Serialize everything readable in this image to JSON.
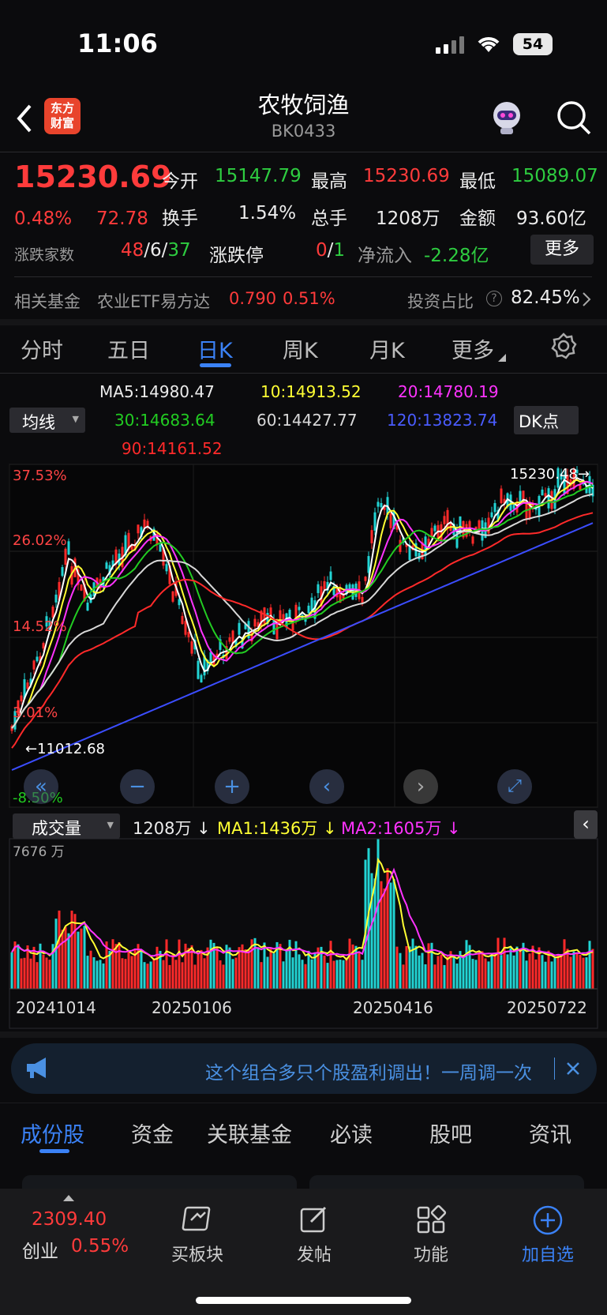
{
  "status": {
    "time": "11:06",
    "battery": "54"
  },
  "header": {
    "title": "农牧饲渔",
    "code": "BK0433",
    "logo_text": "东方财富"
  },
  "quote": {
    "price": "15230.69",
    "change_pct": "0.48%",
    "change": "72.78",
    "open_label": "今开",
    "open": "15147.79",
    "high_label": "最高",
    "high": "15230.69",
    "low_label": "最低",
    "low": "15089.07",
    "turnover_label": "换手",
    "turnover": "1.54%",
    "volume_label": "总手",
    "volume": "1208万",
    "amount_label": "金额",
    "amount": "93.60亿",
    "updown_label": "涨跌家数",
    "up": "48",
    "flat": "6",
    "down": "37",
    "limit_label": "涨跌停",
    "limit_up": "0",
    "limit_down": "1",
    "netflow_label": "净流入",
    "netflow": "-2.28亿",
    "more_label": "更多"
  },
  "fund": {
    "label": "相关基金",
    "name": "农业ETF易方达",
    "price": "0.790",
    "pct": "0.51%",
    "ratio_label": "投资占比",
    "ratio": "82.45%"
  },
  "tabs": [
    "分时",
    "五日",
    "日K",
    "周K",
    "月K",
    "更多"
  ],
  "ma_panel": {
    "selector": "均线",
    "ma5": "MA5:14980.47",
    "ma10": "10:14913.52",
    "ma20": "20:14780.19",
    "ma30": "30:14683.64",
    "ma60": "60:14427.77",
    "ma120": "120:13823.74",
    "ma90": "90:14161.52",
    "dk": "DK点"
  },
  "chart": {
    "y_labels": [
      "37.53%",
      "26.02%",
      "14.52%",
      "3.01%",
      "-8.50%"
    ],
    "high_mark": "15230.48",
    "low_mark": "11012.68",
    "colors": {
      "ma5": "#ffffff",
      "ma10": "#ffff33",
      "ma20": "#ff33ff",
      "ma30": "#22cc22",
      "ma60": "#d8d8d8",
      "ma120": "#3b4dff",
      "ma90": "#ff2a2a"
    }
  },
  "volume": {
    "selector": "成交量",
    "vol": "1208万",
    "ma1": "MA1:1436万",
    "ma2": "MA2:1605万",
    "max_label": "7676 万",
    "dates": [
      "20241014",
      "20250106",
      "20250416",
      "20250722"
    ]
  },
  "banner": {
    "text": "这个组合多只个股盈利调出！一周调一次"
  },
  "bottom_tabs": [
    "成份股",
    "资金",
    "关联基金",
    "必读",
    "股吧",
    "资讯"
  ],
  "bottom_bar": {
    "index_value": "2309.40",
    "index_name": "创业",
    "index_pct": "0.55%",
    "items": [
      "买板块",
      "发帖",
      "功能",
      "加自选"
    ]
  }
}
